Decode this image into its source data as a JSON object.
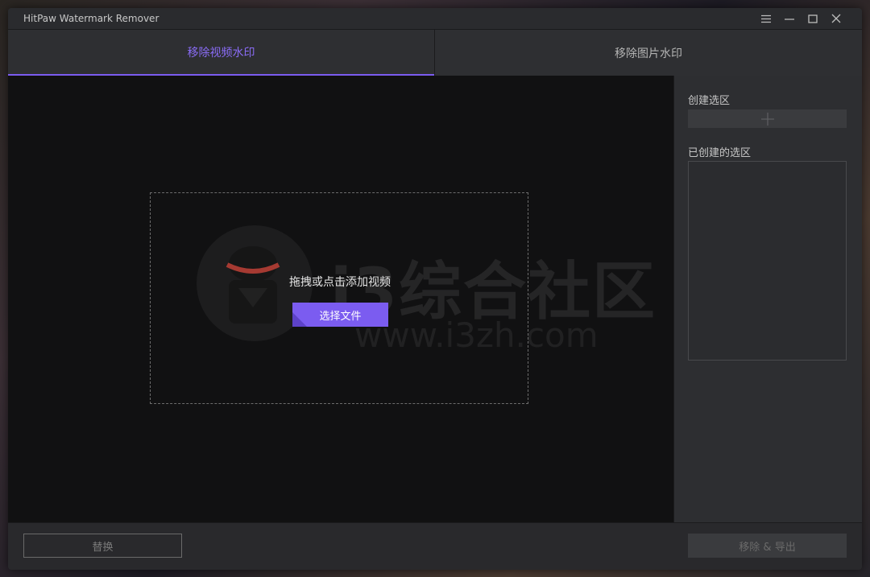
{
  "app": {
    "title": "HitPaw Watermark Remover"
  },
  "window_controls": [
    "menu-icon",
    "minimize-icon",
    "maximize-icon",
    "close-icon"
  ],
  "tabs": [
    {
      "label": "移除视频水印",
      "active": true
    },
    {
      "label": "移除图片水印",
      "active": false
    }
  ],
  "dropzone": {
    "prompt": "拖拽或点击添加视频",
    "select_button": "选择文件"
  },
  "watermark": {
    "text": "i3综合社区",
    "url": "www.i3zh.com"
  },
  "side_panel": {
    "create_label": "创建选区",
    "created_label": "已创建的选区"
  },
  "bottom": {
    "replace_button": "替换",
    "export_button": "移除 & 导出"
  },
  "colors": {
    "accent": "#7b5cf0",
    "stage_bg": "#111112",
    "panel_bg": "#2d2e31"
  }
}
